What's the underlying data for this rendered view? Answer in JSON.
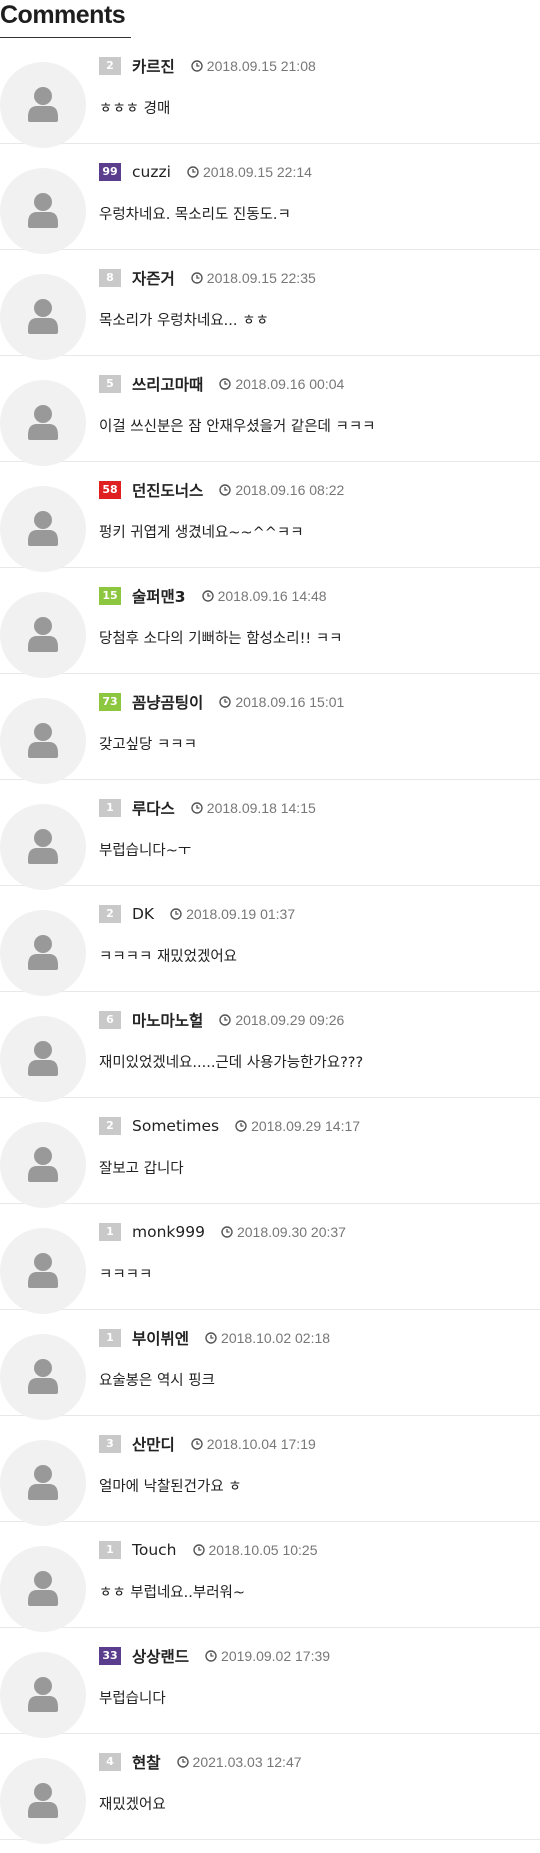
{
  "header": {
    "title": "Comments"
  },
  "level_colors": {
    "gray": "#c9c9c9",
    "purple": "#5a3d8c",
    "red": "#e02020",
    "green": "#8dc63f"
  },
  "comments": [
    {
      "level": "2",
      "level_color": "gray",
      "nickname": "카르진",
      "time": "2018.09.15 21:08",
      "text": "ㅎㅎㅎ  경매"
    },
    {
      "level": "99",
      "level_color": "purple",
      "nickname": "cuzzi",
      "time": "2018.09.15 22:14",
      "text": "우렁차네요. 목소리도 진동도.ㅋ"
    },
    {
      "level": "8",
      "level_color": "gray",
      "nickname": "자즌거",
      "time": "2018.09.15 22:35",
      "text": "목소리가 우렁차네요... ㅎㅎ"
    },
    {
      "level": "5",
      "level_color": "gray",
      "nickname": "쓰리고마때",
      "time": "2018.09.16 00:04",
      "text": "이걸 쓰신분은 잠 안재우셨을거 같은데 ㅋㅋㅋ"
    },
    {
      "level": "58",
      "level_color": "red",
      "nickname": "던진도너스",
      "time": "2018.09.16 08:22",
      "text": "펑키 귀엽게 생겼네요~~^^ㅋㅋ"
    },
    {
      "level": "15",
      "level_color": "green",
      "nickname": "술퍼맨3",
      "time": "2018.09.16 14:48",
      "text": "당첨후 소다의 기뻐하는 함성소리!! ㅋㅋ"
    },
    {
      "level": "73",
      "level_color": "green",
      "nickname": "꼼냥곰팅이",
      "time": "2018.09.16 15:01",
      "text": "갖고싶당 ㅋㅋㅋ"
    },
    {
      "level": "1",
      "level_color": "gray",
      "nickname": "루다스",
      "time": "2018.09.18 14:15",
      "text": "부럽습니다~ㅜ"
    },
    {
      "level": "2",
      "level_color": "gray",
      "nickname": "DK",
      "time": "2018.09.19 01:37",
      "text": "ㅋㅋㅋㅋ 재밌었겠어요"
    },
    {
      "level": "6",
      "level_color": "gray",
      "nickname": "마노마노헐",
      "time": "2018.09.29 09:26",
      "text": "재미있었겠네요.....근데 사용가능한가요???"
    },
    {
      "level": "2",
      "level_color": "gray",
      "nickname": "Sometimes",
      "time": "2018.09.29 14:17",
      "text": "잘보고 갑니다"
    },
    {
      "level": "1",
      "level_color": "gray",
      "nickname": "monk999",
      "time": "2018.09.30 20:37",
      "text": "ㅋㅋㅋㅋ"
    },
    {
      "level": "1",
      "level_color": "gray",
      "nickname": "부이뷔엔",
      "time": "2018.10.02 02:18",
      "text": "요술봉은 역시 핑크"
    },
    {
      "level": "3",
      "level_color": "gray",
      "nickname": "산만디",
      "time": "2018.10.04 17:19",
      "text": "얼마에 낙찰된건가요 ㅎ"
    },
    {
      "level": "1",
      "level_color": "gray",
      "nickname": "Touch",
      "time": "2018.10.05 10:25",
      "text": "ㅎㅎ 부럽네요..부러워~"
    },
    {
      "level": "33",
      "level_color": "purple",
      "nickname": "상상랜드",
      "time": "2019.09.02 17:39",
      "text": "부럽습니다"
    },
    {
      "level": "4",
      "level_color": "gray",
      "nickname": "현찰",
      "time": "2021.03.03 12:47",
      "text": "재밌겠어요"
    }
  ]
}
